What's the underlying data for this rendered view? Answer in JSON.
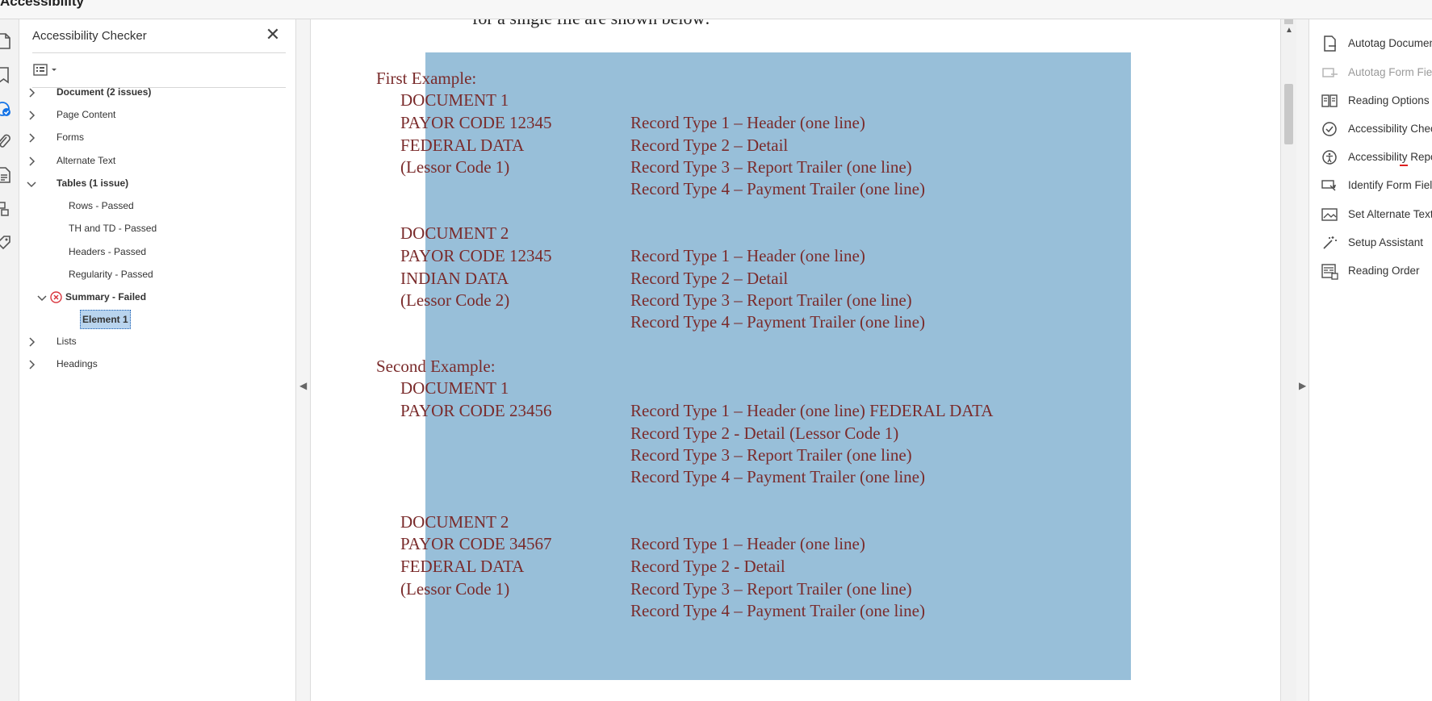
{
  "app": {
    "title": "Accessibility"
  },
  "checker": {
    "title": "Accessibility Checker",
    "close_glyph": "✕",
    "tree": [
      {
        "label": "Document (2 issues)",
        "bold": true,
        "expanded": false
      },
      {
        "label": "Page Content",
        "bold": false,
        "expanded": false
      },
      {
        "label": "Forms",
        "bold": false,
        "expanded": false
      },
      {
        "label": "Alternate Text",
        "bold": false,
        "expanded": false
      },
      {
        "label": "Tables (1 issue)",
        "bold": true,
        "expanded": true
      },
      {
        "label": "Rows - Passed"
      },
      {
        "label": "TH and TD - Passed"
      },
      {
        "label": "Headers - Passed"
      },
      {
        "label": "Regularity - Passed"
      },
      {
        "label": "Summary - Failed",
        "bold": true,
        "expanded": true,
        "status": "failed"
      },
      {
        "label": "Element 1",
        "bold": true,
        "selected": true
      },
      {
        "label": "Lists",
        "bold": false,
        "expanded": false
      },
      {
        "label": "Headings",
        "bold": false,
        "expanded": false
      }
    ]
  },
  "document": {
    "cut_line": "for a single file are shown below:",
    "lines": [
      {
        "left": "First Example:",
        "right": ""
      },
      {
        "left": "DOCUMENT 1",
        "right": ""
      },
      {
        "left": "PAYOR CODE 12345",
        "right": "Record Type 1 – Header (one line)"
      },
      {
        "left": "FEDERAL DATA",
        "right": "Record Type 2 – Detail"
      },
      {
        "left": "(Lessor Code 1)",
        "right": "Record Type 3 – Report Trailer (one line)"
      },
      {
        "left": "",
        "right": "Record Type 4 – Payment Trailer (one line)"
      },
      {
        "left": "DOCUMENT 2",
        "right": ""
      },
      {
        "left": "PAYOR CODE 12345",
        "right": "Record Type 1 – Header (one line)"
      },
      {
        "left": "INDIAN DATA",
        "right": "Record Type 2 – Detail"
      },
      {
        "left": "(Lessor Code 2)",
        "right": "Record Type 3 – Report Trailer (one line)"
      },
      {
        "left": "",
        "right": "Record Type 4 – Payment Trailer (one line)"
      },
      {
        "left": "Second Example:",
        "right": ""
      },
      {
        "left": "DOCUMENT 1",
        "right": ""
      },
      {
        "left": "PAYOR CODE 23456",
        "right": "Record Type 1 – Header (one line)  FEDERAL DATA"
      },
      {
        "left": "",
        "right": "Record Type 2 - Detail  (Lessor Code 1)"
      },
      {
        "left": "",
        "right": "Record Type 3 – Report Trailer (one line)"
      },
      {
        "left": "",
        "right": "Record Type 4 – Payment Trailer (one line)"
      },
      {
        "left": "DOCUMENT 2",
        "right": ""
      },
      {
        "left": "PAYOR CODE 34567",
        "right": "Record Type 1 – Header (one line)"
      },
      {
        "left": "FEDERAL DATA",
        "right": "Record Type 2 - Detail"
      },
      {
        "left": "(Lessor Code 1)",
        "right": "Record Type 3 – Report Trailer (one line)"
      },
      {
        "left": "",
        "right": "Record Type 4 – Payment Trailer (one line)"
      }
    ]
  },
  "tools": [
    {
      "label": "Autotag Document",
      "icon": "autotag-document-icon",
      "enabled": true
    },
    {
      "label": "Autotag Form Fields",
      "icon": "autotag-form-icon",
      "enabled": false
    },
    {
      "label": "Reading Options",
      "icon": "reading-options-icon",
      "enabled": true
    },
    {
      "label": "Accessibility Check",
      "icon": "accessibility-check-icon",
      "enabled": true
    },
    {
      "label": "Accessibility Report",
      "icon": "accessibility-report-icon",
      "enabled": true
    },
    {
      "label": "Identify Form Fields",
      "icon": "identify-form-fields-icon",
      "enabled": true
    },
    {
      "label": "Set Alternate Text",
      "icon": "set-alternate-text-icon",
      "enabled": true
    },
    {
      "label": "Setup Assistant",
      "icon": "setup-assistant-icon",
      "enabled": true
    },
    {
      "label": "Reading Order",
      "icon": "reading-order-icon",
      "enabled": true
    }
  ],
  "colors": {
    "highlight": "#98bfd9",
    "doc_text": "#7a2b2b",
    "error": "#d9363e"
  }
}
